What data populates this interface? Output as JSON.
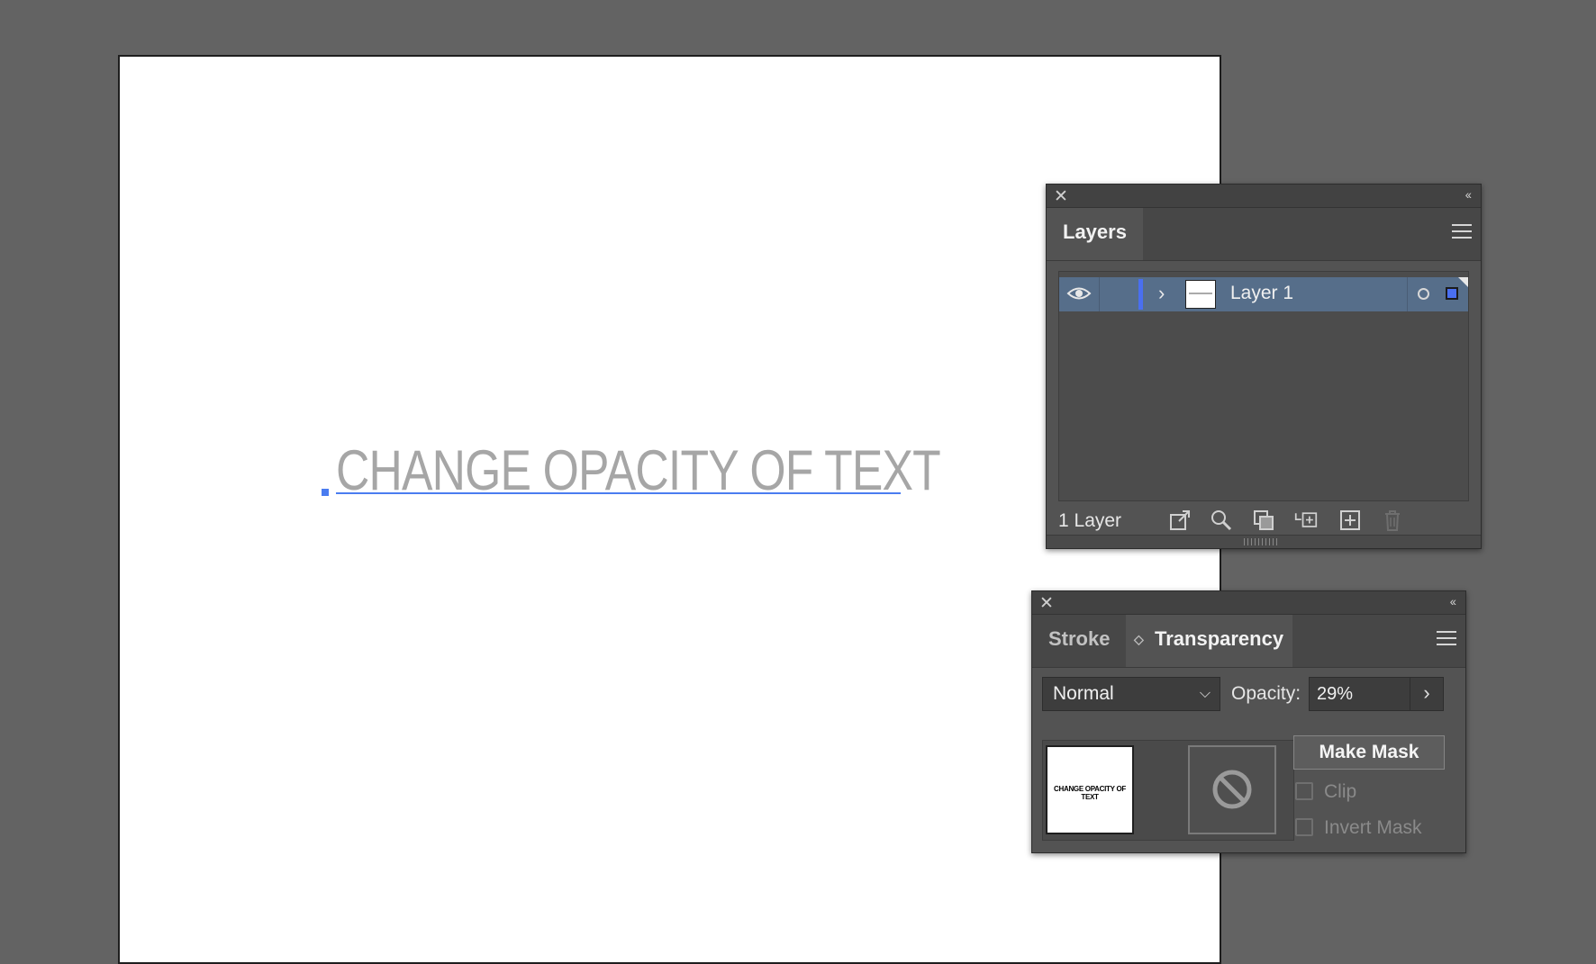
{
  "canvas": {
    "text": "CHANGE OPACITY OF TEXT"
  },
  "layers_panel": {
    "tab_label": "Layers",
    "layer_name": "Layer 1",
    "layer_count": "1 Layer",
    "icons": [
      "export-icon",
      "search-icon",
      "clipping-mask-icon",
      "new-sublayer-icon",
      "new-layer-icon",
      "trash-icon"
    ]
  },
  "transparency_panel": {
    "tabs": [
      "Stroke",
      "Transparency"
    ],
    "active_tab": "Transparency",
    "blend_mode": "Normal",
    "opacity_label": "Opacity:",
    "opacity_value": "29%",
    "thumbnail_text": "CHANGE OPACITY OF TEXT",
    "make_mask_label": "Make Mask",
    "clip_label": "Clip",
    "invert_mask_label": "Invert Mask"
  },
  "colors": {
    "selection": "#4a6ff0",
    "panel_bg": "#535353",
    "workspace": "#636363"
  }
}
